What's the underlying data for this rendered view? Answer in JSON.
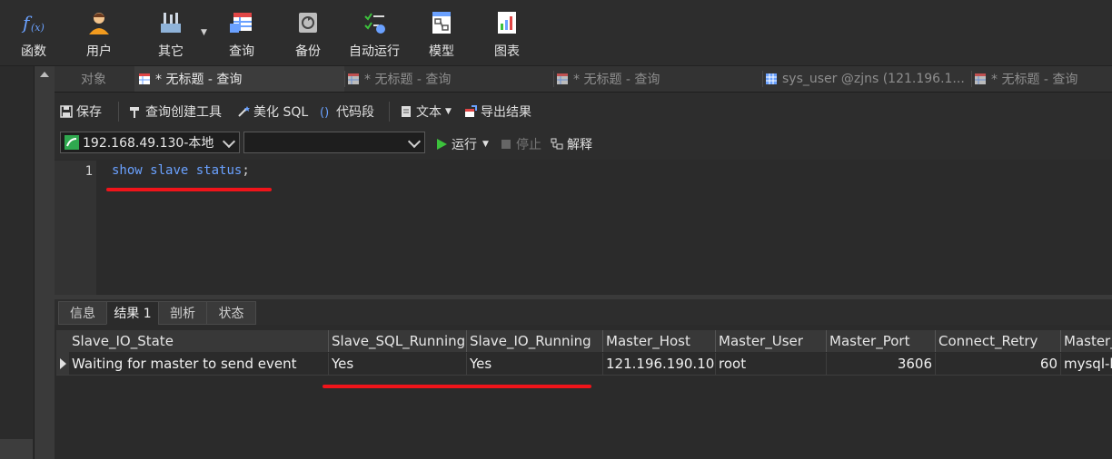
{
  "toolbar": {
    "items": [
      {
        "label": "函数",
        "icon": "function-icon"
      },
      {
        "label": "用户",
        "icon": "user-icon"
      },
      {
        "label": "其它",
        "icon": "tools-icon"
      },
      {
        "label": "查询",
        "icon": "query-icon"
      },
      {
        "label": "备份",
        "icon": "backup-icon"
      },
      {
        "label": "自动运行",
        "icon": "schedule-icon"
      },
      {
        "label": "模型",
        "icon": "model-icon"
      },
      {
        "label": "图表",
        "icon": "chart-icon"
      }
    ]
  },
  "tabs": [
    {
      "label": "对象"
    },
    {
      "label": "* 无标题 - 查询"
    },
    {
      "label": "* 无标题 - 查询"
    },
    {
      "label": "* 无标题 - 查询"
    },
    {
      "label": "sys_user @zjns (121.196.1..."
    },
    {
      "label": "* 无标题 - 查询"
    }
  ],
  "actions": {
    "save": "保存",
    "query_builder": "查询创建工具",
    "beautify": "美化 SQL",
    "snippet": "代码段",
    "text": "文本",
    "export": "导出结果",
    "run": "运行",
    "stop": "停止",
    "explain": "解释"
  },
  "connection": {
    "selected": "192.168.49.130-本地",
    "database": ""
  },
  "editor": {
    "line": "1",
    "tokens": [
      "show",
      " ",
      "slave",
      " ",
      "status",
      ";"
    ]
  },
  "result_tabs": [
    {
      "label": "信息"
    },
    {
      "label": "结果 1"
    },
    {
      "label": "剖析"
    },
    {
      "label": "状态"
    }
  ],
  "grid": {
    "columns": [
      "Slave_IO_State",
      "Slave_SQL_Running",
      "Slave_IO_Running",
      "Master_Host",
      "Master_User",
      "Master_Port",
      "Connect_Retry",
      "Master_"
    ],
    "rows": [
      [
        "Waiting for master to send event",
        "Yes",
        "Yes",
        "121.196.190.104",
        "root",
        "3606",
        "60",
        "mysql-b"
      ]
    ]
  },
  "colors": {
    "accent": "#6aa1ff",
    "annotation": "#f0141a",
    "run": "#3cc23c"
  }
}
